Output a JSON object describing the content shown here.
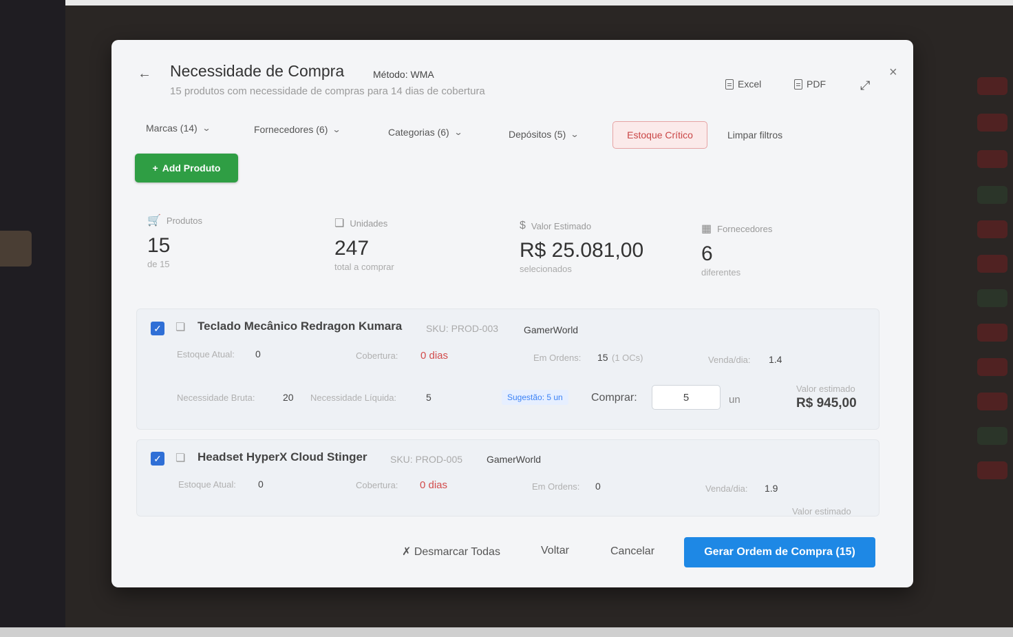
{
  "header": {
    "back_icon": "arrow-left-icon",
    "title": "Necessidade de Compra",
    "method": "Método: WMA",
    "subtitle": "15 produtos com necessidade de compras para 14 dias de cobertura",
    "excel_label": "Excel",
    "pdf_label": "PDF"
  },
  "filters": {
    "marcas": "Marcas (14)",
    "fornecedores": "Fornecedores (6)",
    "categorias": "Categorias (6)",
    "depositos": "Depósitos (5)",
    "estoque_critico": "Estoque Crítico",
    "limpar": "Limpar filtros"
  },
  "add_button": "Add Produto",
  "stats": {
    "produtos": {
      "label": "Produtos",
      "value": "15",
      "sub": "de 15"
    },
    "unidades": {
      "label": "Unidades",
      "value": "247",
      "sub": "total a comprar"
    },
    "valor": {
      "label": "Valor Estimado",
      "value": "R$ 25.081,00",
      "sub": "selecionados"
    },
    "fornecedores": {
      "label": "Fornecedores",
      "value": "6",
      "sub": "diferentes"
    }
  },
  "products": [
    {
      "name": "Teclado Mecânico Redragon Kumara",
      "sku": "SKU: PROD-003",
      "supplier": "GamerWorld",
      "estoque_label": "Estoque Atual:",
      "estoque_value": "0",
      "cobertura_label": "Cobertura:",
      "cobertura_value": "0 dias",
      "ordens_label": "Em Ordens:",
      "ordens_value": "15",
      "ordens_extra": "(1 OCs)",
      "venda_label": "Venda/dia:",
      "venda_value": "1.4",
      "bruta_label": "Necessidade Bruta:",
      "bruta_value": "20",
      "liquida_label": "Necessidade Líquida:",
      "liquida_value": "5",
      "sugestao": "Sugestão: 5 un",
      "comprar_label": "Comprar:",
      "comprar_value": "5",
      "unit": "un",
      "valor_label": "Valor estimado",
      "valor_value": "R$ 945,00"
    },
    {
      "name": "Headset HyperX Cloud Stinger",
      "sku": "SKU: PROD-005",
      "supplier": "GamerWorld",
      "estoque_label": "Estoque Atual:",
      "estoque_value": "0",
      "cobertura_label": "Cobertura:",
      "cobertura_value": "0 dias",
      "ordens_label": "Em Ordens:",
      "ordens_value": "0",
      "venda_label": "Venda/dia:",
      "venda_value": "1.9",
      "valor_label": "Valor estimado"
    }
  ],
  "footer": {
    "desmarcar": "✗ Desmarcar Todas",
    "voltar": "Voltar",
    "cancelar": "Cancelar",
    "gerar": "Gerar Ordem de Compra (15)"
  }
}
